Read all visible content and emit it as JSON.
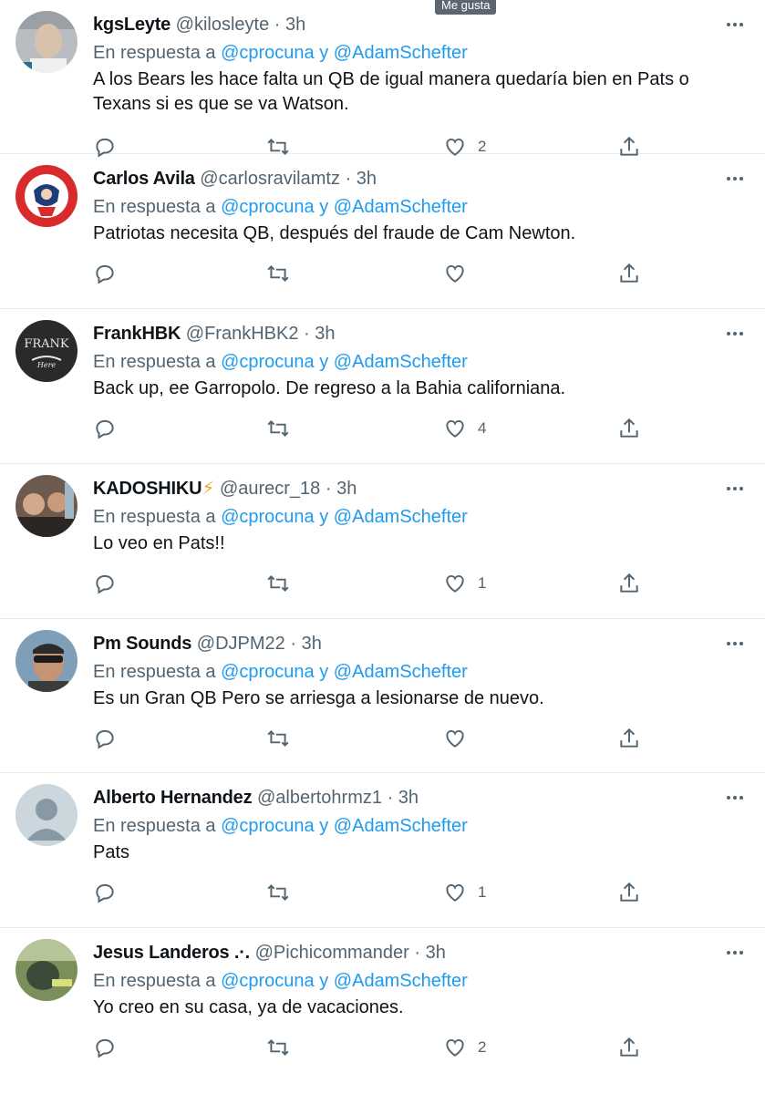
{
  "tooltip": "Me gusta",
  "reply_prefix": "En respuesta a",
  "reply_and": "y",
  "mention_1": "@cprocuna",
  "mention_2": "@AdamSchefter",
  "tweets": [
    {
      "name": "kgsLeyte",
      "handle": "@kilosleyte",
      "time": "3h",
      "text": "A los Bears les hace falta un QB de igual manera quedaría bien en Pats o Texans si es que se va Watson.",
      "likes": "2",
      "avatar": "photo-man"
    },
    {
      "name": "Carlos Avila",
      "handle": "@carlosravilamtz",
      "time": "3h",
      "text": "Patriotas necesita QB, después del fraude de Cam Newton.",
      "likes": "",
      "avatar": "patriots-logo"
    },
    {
      "name": "FrankHBK",
      "handle": "@FrankHBK2",
      "time": "3h",
      "text": "Back up, ee Garropolo. De regreso a la Bahia californiana.",
      "likes": "4",
      "avatar": "frank-logo"
    },
    {
      "name": "KADOSHIKU",
      "name_suffix": "⚡",
      "handle": "@aurecr_18",
      "time": "3h",
      "text": "Lo veo en Pats!!",
      "likes": "1",
      "avatar": "photo-group"
    },
    {
      "name": "Pm Sounds",
      "handle": "@DJPM22",
      "time": "3h",
      "text": "Es un Gran QB Pero se arriesga a lesionarse de nuevo.",
      "likes": "",
      "avatar": "photo-sunglasses"
    },
    {
      "name": "Alberto Hernandez",
      "handle": "@albertohrmz1",
      "time": "3h",
      "text": "Pats",
      "likes": "1",
      "avatar": "default-avatar"
    },
    {
      "name": "Jesus Landeros .·.",
      "handle": "@Pichicommander",
      "time": "3h",
      "text": "Yo creo en su casa, ya de vacaciones.",
      "likes": "2",
      "avatar": "photo-outdoor"
    }
  ],
  "colors": {
    "accent": "#1d9bf0",
    "muted": "#536471",
    "divider": "#e6ecf0"
  }
}
